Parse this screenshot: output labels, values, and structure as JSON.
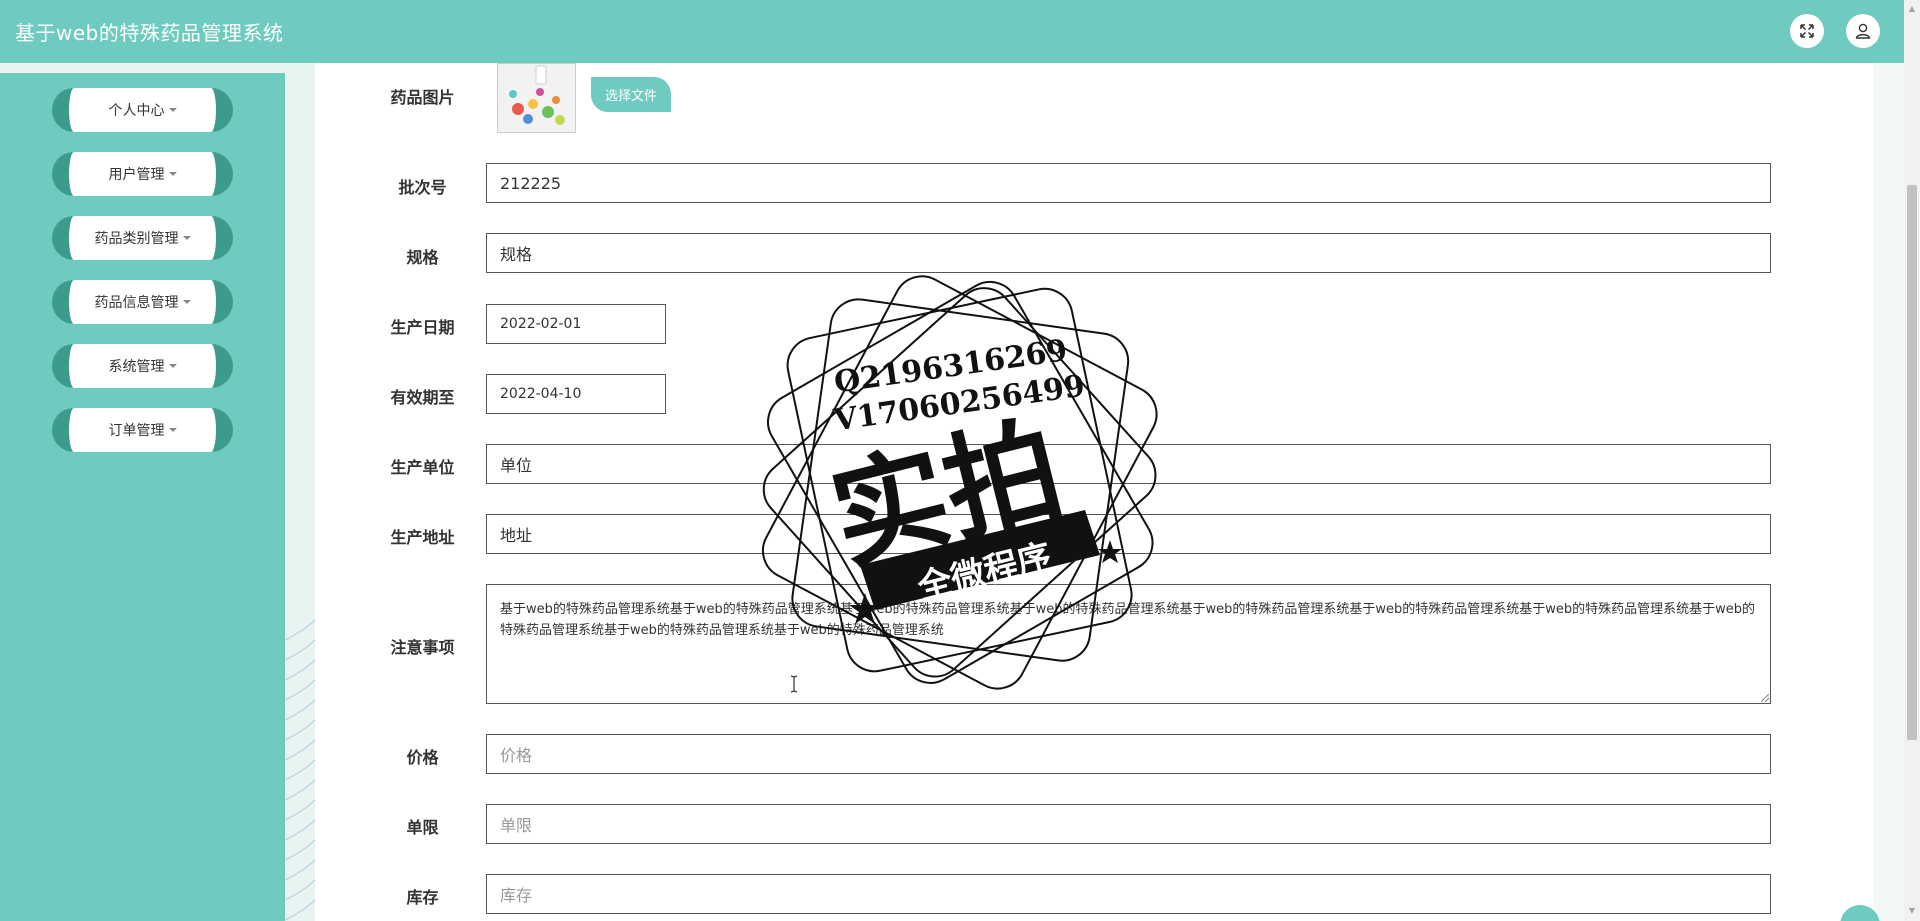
{
  "header": {
    "title": "基于web的特殊药品管理系统",
    "icons": [
      "fullscreen-icon",
      "user-icon"
    ]
  },
  "sidebar": {
    "items": [
      {
        "label": "个人中心"
      },
      {
        "label": "用户管理"
      },
      {
        "label": "药品类别管理"
      },
      {
        "label": "药品信息管理"
      },
      {
        "label": "系统管理"
      },
      {
        "label": "订单管理"
      }
    ]
  },
  "form": {
    "image": {
      "label": "药品图片",
      "button": "选择文件"
    },
    "batch": {
      "label": "批次号",
      "value": "212225"
    },
    "spec": {
      "label": "规格",
      "value": "规格"
    },
    "production_date": {
      "label": "生产日期",
      "value": "2022-02-01"
    },
    "expiry": {
      "label": "有效期至",
      "value": "2022-04-10"
    },
    "manufacturer": {
      "label": "生产单位",
      "value": "单位"
    },
    "address": {
      "label": "生产地址",
      "value": "地址"
    },
    "notes": {
      "label": "注意事项",
      "value": "基于web的特殊药品管理系统基于web的特殊药品管理系统基于web的特殊药品管理系统基于web的特殊药品管理系统基于web的特殊药品管理系统基于web的特殊药品管理系统基于web的特殊药品管理系统基于web的特殊药品管理系统基于web的特殊药品管理系统基于web的特殊药品管理系统"
    },
    "price": {
      "label": "价格",
      "placeholder": "价格"
    },
    "limit": {
      "label": "单限",
      "placeholder": "单限"
    },
    "stock": {
      "label": "库存",
      "placeholder": "库存"
    }
  },
  "watermark": {
    "line1": "Q2196316269",
    "line2": "V17060256499",
    "main": "实拍",
    "banner": "全微程序"
  },
  "colors": {
    "accent": "#6fcbbf",
    "accent_dark": "#3d9b8c"
  }
}
